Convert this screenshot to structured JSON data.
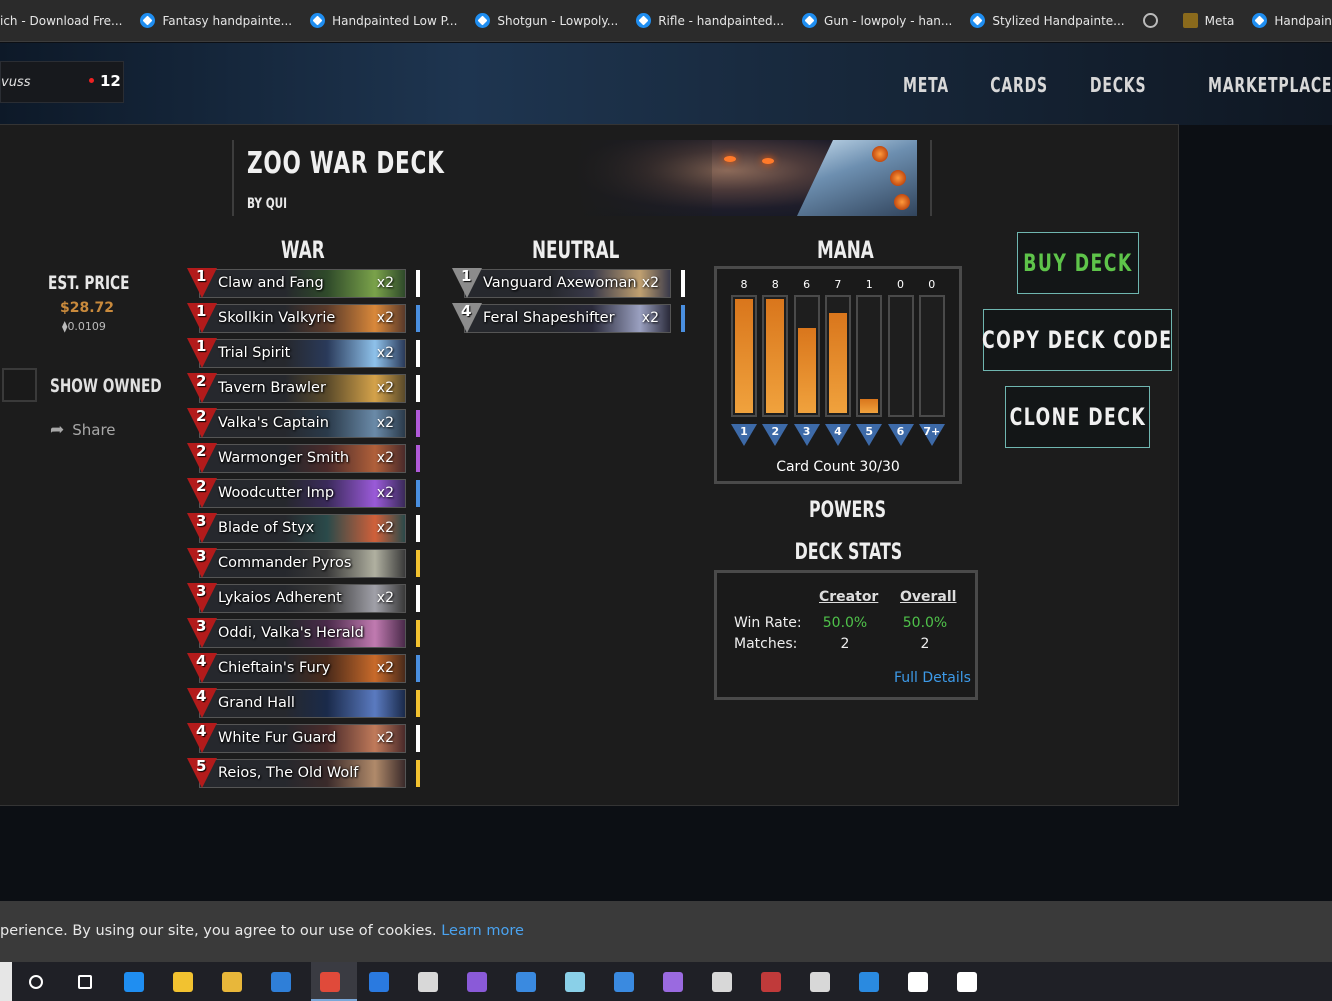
{
  "bookmarks": [
    {
      "label": "ich - Download Fre...",
      "icon": "none"
    },
    {
      "label": "Fantasy handpainte...",
      "icon": "sketchfab-icon"
    },
    {
      "label": "Handpainted Low P...",
      "icon": "sketchfab-icon"
    },
    {
      "label": "Shotgun - Lowpoly...",
      "icon": "sketchfab-icon"
    },
    {
      "label": "Rifle - handpainted...",
      "icon": "sketchfab-icon"
    },
    {
      "label": "Gun - lowpoly - han...",
      "icon": "sketchfab-icon"
    },
    {
      "label": "Stylized Handpainte...",
      "icon": "sketchfab-icon"
    },
    {
      "label": "",
      "icon": "globe-icon"
    },
    {
      "label": "Meta",
      "icon": "meta-icon"
    },
    {
      "label": "Handpainted Tree [...",
      "icon": "sketchfab-icon"
    }
  ],
  "header": {
    "username": "vuss",
    "notification_count": "12",
    "nav": [
      "META",
      "CARDS",
      "DECKS",
      "MARKETPLACE"
    ]
  },
  "deck": {
    "title": "ZOO WAR DECK",
    "author": "BY QUI",
    "est_price_label": "EST. PRICE",
    "est_price_usd": "$28.72",
    "est_price_eth": "0.0109",
    "show_owned_label": "SHOW OWNED",
    "share_label": "Share"
  },
  "columns": {
    "war": "WAR",
    "neutral": "NEUTRAL",
    "mana": "MANA",
    "powers": "POWERS",
    "deck_stats": "DECK STATS"
  },
  "war_cards": [
    {
      "cost": "1",
      "name": "Claw and Fang",
      "qty": "x2",
      "rarity": "#ffffff",
      "art": [
        "#2f4a2a",
        "#7aa24a"
      ]
    },
    {
      "cost": "1",
      "name": "Skollkin Valkyrie",
      "qty": "x2",
      "rarity": "#4a8fe0",
      "art": [
        "#5a3a2a",
        "#d9883a"
      ]
    },
    {
      "cost": "1",
      "name": "Trial Spirit",
      "qty": "x2",
      "rarity": "#ffffff",
      "art": [
        "#2a3a5a",
        "#8ec1ea"
      ]
    },
    {
      "cost": "2",
      "name": "Tavern Brawler",
      "qty": "x2",
      "rarity": "#ffffff",
      "art": [
        "#5a4a2a",
        "#d4a24a"
      ]
    },
    {
      "cost": "2",
      "name": "Valka's Captain",
      "qty": "x2",
      "rarity": "#b05ad8",
      "art": [
        "#2a3a4a",
        "#6a8aa8"
      ]
    },
    {
      "cost": "2",
      "name": "Warmonger Smith",
      "qty": "x2",
      "rarity": "#b05ad8",
      "art": [
        "#4a2a2a",
        "#b0603a"
      ]
    },
    {
      "cost": "2",
      "name": "Woodcutter Imp",
      "qty": "x2",
      "rarity": "#4a8fe0",
      "art": [
        "#3a2a5a",
        "#9a5ad8"
      ]
    },
    {
      "cost": "3",
      "name": "Blade of Styx",
      "qty": "x2",
      "rarity": "#ffffff",
      "art": [
        "#2a4a4a",
        "#d0603a"
      ]
    },
    {
      "cost": "3",
      "name": "Commander Pyros",
      "qty": "",
      "rarity": "#f2c230",
      "art": [
        "#3a3a3a",
        "#b0b0a0"
      ]
    },
    {
      "cost": "3",
      "name": "Lykaios Adherent",
      "qty": "x2",
      "rarity": "#ffffff",
      "art": [
        "#3a3a3a",
        "#a0a0a8"
      ]
    },
    {
      "cost": "3",
      "name": "Oddi, Valka's Herald",
      "qty": "",
      "rarity": "#f2c230",
      "art": [
        "#4a2a4a",
        "#c07ab0"
      ]
    },
    {
      "cost": "4",
      "name": "Chieftain's Fury",
      "qty": "x2",
      "rarity": "#4a8fe0",
      "art": [
        "#4a2a1a",
        "#c86a2a"
      ]
    },
    {
      "cost": "4",
      "name": "Grand Hall",
      "qty": "",
      "rarity": "#f2c230",
      "art": [
        "#1a2a4a",
        "#5a7ac0"
      ]
    },
    {
      "cost": "4",
      "name": "White Fur Guard",
      "qty": "x2",
      "rarity": "#ffffff",
      "art": [
        "#4a2a2a",
        "#c07a5a"
      ]
    },
    {
      "cost": "5",
      "name": "Reios, The Old Wolf",
      "qty": "",
      "rarity": "#f2c230",
      "art": [
        "#3a2a2a",
        "#b08a6a"
      ]
    }
  ],
  "neutral_cards": [
    {
      "cost": "1",
      "name": "Vanguard Axewoman",
      "qty": "x2",
      "rarity": "#ffffff",
      "art": [
        "#3a3a4a",
        "#c0a070"
      ]
    },
    {
      "cost": "4",
      "name": "Feral Shapeshifter",
      "qty": "x2",
      "rarity": "#4a8fe0",
      "art": [
        "#2a2a3a",
        "#9aa0c0"
      ]
    }
  ],
  "mana_curve": {
    "labels": [
      "1",
      "2",
      "3",
      "4",
      "5",
      "6",
      "7+"
    ],
    "counts": [
      8,
      8,
      6,
      7,
      1,
      0,
      0
    ],
    "max": 8,
    "card_count": "Card Count 30/30"
  },
  "stats": {
    "creator_label": "Creator",
    "overall_label": "Overall",
    "win_rate_label": "Win Rate:",
    "matches_label": "Matches:",
    "creator_win_rate": "50.0%",
    "overall_win_rate": "50.0%",
    "creator_matches": "2",
    "overall_matches": "2",
    "full_details": "Full Details"
  },
  "buttons": {
    "buy": "BUY DECK",
    "copy": "COPY DECK CODE",
    "clone": "CLONE DECK"
  },
  "cookie": {
    "text": "perience. By using our site, you agree to our use of cookies.",
    "link": "Learn more"
  },
  "taskbar": [
    {
      "name": "search-icon",
      "color": "#ffffff"
    },
    {
      "name": "task-view-icon",
      "color": "#ffffff"
    },
    {
      "name": "edge-icon",
      "color": "#1f8ef1"
    },
    {
      "name": "store-icon",
      "color": "#f2c230"
    },
    {
      "name": "file-explorer-icon",
      "color": "#e8b73a"
    },
    {
      "name": "mail-icon",
      "color": "#2f7fd8"
    },
    {
      "name": "chrome-icon",
      "color": "#e04a3a"
    },
    {
      "name": "trello-icon",
      "color": "#2a7ae0"
    },
    {
      "name": "wordpress-icon",
      "color": "#d8d8d8"
    },
    {
      "name": "visual-studio-icon",
      "color": "#8a5ad8"
    },
    {
      "name": "app-icon",
      "color": "#3a8ae0"
    },
    {
      "name": "notepad-icon",
      "color": "#8ad0e8"
    },
    {
      "name": "media-icon",
      "color": "#3a8ae0"
    },
    {
      "name": "vs-code-icon",
      "color": "#9a6ae0"
    },
    {
      "name": "notes-icon",
      "color": "#d8d8d8"
    },
    {
      "name": "winrar-icon",
      "color": "#c03a3a"
    },
    {
      "name": "snip-icon",
      "color": "#d8d8d8"
    },
    {
      "name": "photos-icon",
      "color": "#2a8ae0"
    },
    {
      "name": "unity-icon",
      "color": "#ffffff"
    },
    {
      "name": "chatgpt-icon",
      "color": "#ffffff"
    }
  ]
}
